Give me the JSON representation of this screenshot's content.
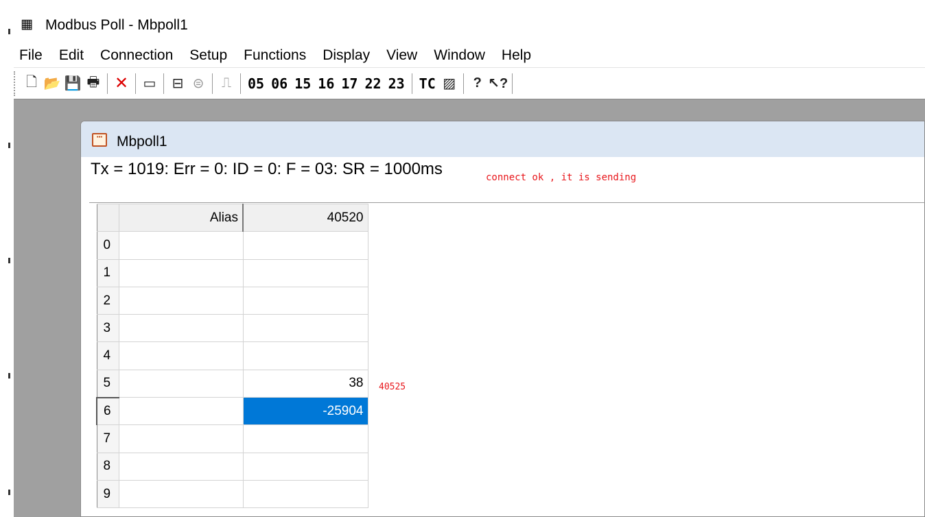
{
  "app": {
    "title": "Modbus Poll - Mbpoll1",
    "icon": "modbus-poll-app-icon"
  },
  "menu": [
    "File",
    "Edit",
    "Connection",
    "Setup",
    "Functions",
    "Display",
    "View",
    "Window",
    "Help"
  ],
  "toolbar": {
    "function_codes": [
      "05",
      "06",
      "15",
      "16",
      "17",
      "22",
      "23"
    ],
    "tc_label": "TC"
  },
  "child_window": {
    "title": "Mbpoll1",
    "status_line": "Tx = 1019: Err = 0: ID = 0: F = 03: SR = 1000ms",
    "annotation": "connect ok  , it is sending",
    "grid": {
      "headers": {
        "alias": "Alias",
        "address": "40520"
      },
      "rows": [
        {
          "index": "0",
          "alias": "",
          "value": ""
        },
        {
          "index": "1",
          "alias": "",
          "value": ""
        },
        {
          "index": "2",
          "alias": "",
          "value": ""
        },
        {
          "index": "3",
          "alias": "",
          "value": ""
        },
        {
          "index": "4",
          "alias": "",
          "value": ""
        },
        {
          "index": "5",
          "alias": "",
          "value": "38"
        },
        {
          "index": "6",
          "alias": "",
          "value": "-25904"
        },
        {
          "index": "7",
          "alias": "",
          "value": ""
        },
        {
          "index": "8",
          "alias": "",
          "value": ""
        },
        {
          "index": "9",
          "alias": "",
          "value": ""
        }
      ],
      "selected_row": 6,
      "side_note": "40525"
    }
  },
  "colors": {
    "selection": "#0078d7",
    "annotation": "#e8171c",
    "mdi_background": "#a0a0a0",
    "child_titlebar": "#dbe6f3"
  }
}
